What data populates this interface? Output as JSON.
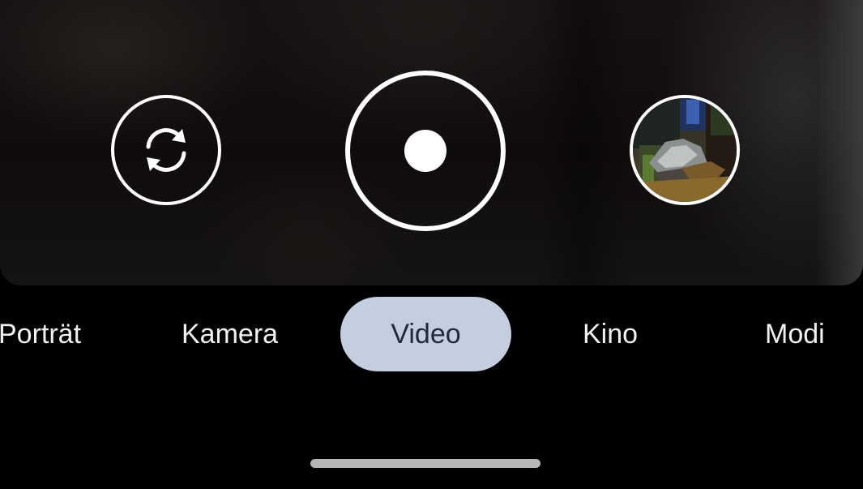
{
  "app": {
    "current_mode": "Video"
  },
  "controls": {
    "switch_camera_icon": "camera-switch-icon",
    "shutter_icon": "record-icon",
    "gallery_thumbnail": "last-capture-thumbnail"
  },
  "modes": [
    {
      "label": "Porträt",
      "selected": false
    },
    {
      "label": "Kamera",
      "selected": false
    },
    {
      "label": "Video",
      "selected": true
    },
    {
      "label": "Kino",
      "selected": false
    },
    {
      "label": "Modi",
      "selected": false
    }
  ],
  "colors": {
    "background": "#000000",
    "selected_mode_pill": "#c3cedf",
    "selected_mode_text": "#1f2a3a",
    "mode_text": "#f1f1f1",
    "controls": "#ffffff",
    "home_indicator": "#b5b5b5"
  }
}
